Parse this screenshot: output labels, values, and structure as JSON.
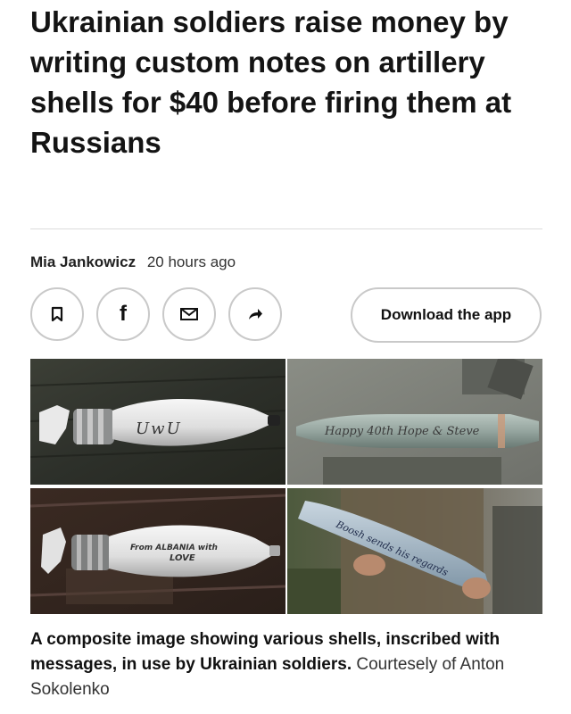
{
  "article": {
    "headline": "Ukrainian soldiers raise money by writing custom notes on artillery shells for $40 before firing them at Russians",
    "author": "Mia Jankowicz",
    "time_ago": "20 hours ago"
  },
  "actions": {
    "bookmark_icon": "bookmark-icon",
    "facebook_icon": "facebook-icon",
    "facebook_glyph": "f",
    "email_icon": "email-icon",
    "share_icon": "share-arrow-icon",
    "download_app_label": "Download the app"
  },
  "photos": {
    "shell_1_text": "UwU",
    "shell_2_text": "Happy 40th Hope & Steve",
    "shell_3_text_line1": "From ALBANIA with",
    "shell_3_text_line2": "LOVE",
    "shell_4_text_line1": "Boosh sends his regards"
  },
  "caption": {
    "main": "A composite image showing various shells, inscribed with messages, in use by Ukrainian soldiers.",
    "credit": "Courtesely of Anton Sokolenko"
  }
}
